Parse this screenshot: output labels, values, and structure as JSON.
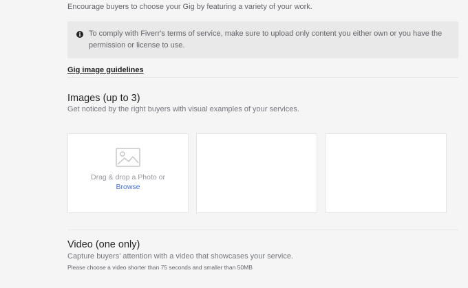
{
  "intro_text": "Encourage buyers to choose your Gig by featuring a variety of your work.",
  "notice": {
    "icon": "info-icon",
    "text": "To comply with Fiverr's terms of service, make sure to upload only content you either own or you have the permission or license to use."
  },
  "guidelines_link": "Gig image guidelines",
  "images": {
    "title": "Images (up to 3)",
    "description": "Get noticed by the right buyers with visual examples of your services.",
    "upload": {
      "icon": "image-placeholder-icon",
      "drag_text": "Drag & drop a Photo or",
      "browse_label": "Browse"
    }
  },
  "video": {
    "title": "Video (one only)",
    "description": "Capture buyers' attention with a video that showcases your service.",
    "note": "Please choose a video shorter than 75 seconds and smaller than 50MB"
  },
  "colors": {
    "accent_link": "#446ee7",
    "background": "#f5f5f5",
    "notice_background": "#e9e9e9"
  }
}
